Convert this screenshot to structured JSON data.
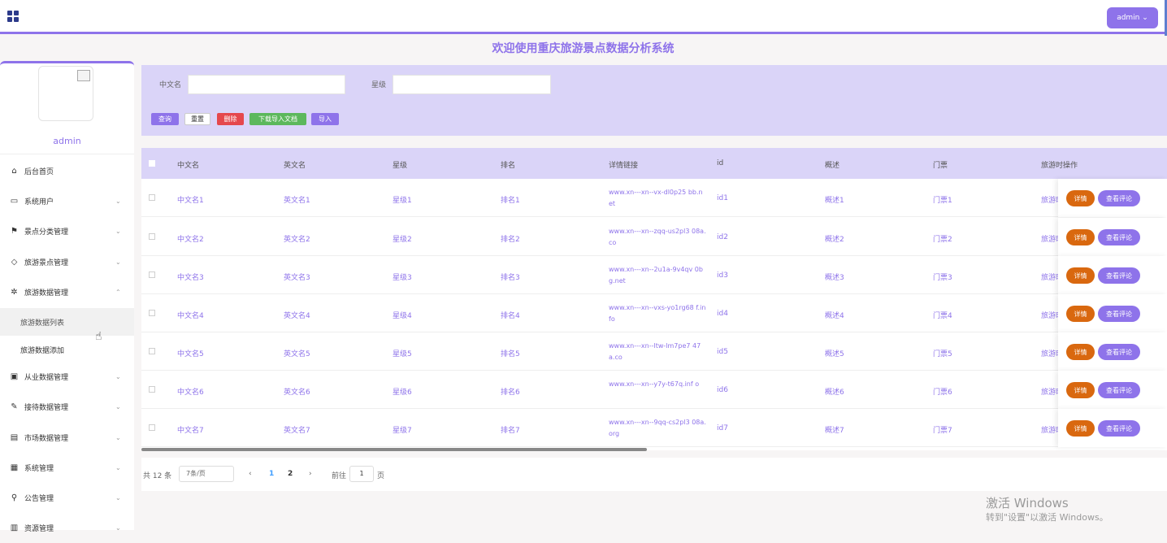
{
  "topbar": {
    "admin_label": "admin ⌄"
  },
  "header": {
    "title": "欢迎使用重庆旅游景点数据分析系统"
  },
  "sidebar": {
    "username": "admin",
    "items": [
      {
        "label": "后台首页",
        "icon": "⌂"
      },
      {
        "label": "系统用户",
        "icon": "▭"
      },
      {
        "label": "景点分类管理",
        "icon": "⚑"
      },
      {
        "label": "旅游景点管理",
        "icon": "◇"
      },
      {
        "label": "旅游数据管理",
        "icon": "✲"
      },
      {
        "label": "从业数据管理",
        "icon": "▣"
      },
      {
        "label": "接待数据管理",
        "icon": "✎"
      },
      {
        "label": "市场数据管理",
        "icon": "▤"
      },
      {
        "label": "系统管理",
        "icon": "▦"
      },
      {
        "label": "公告管理",
        "icon": "⚲"
      },
      {
        "label": "资源管理",
        "icon": "▥"
      }
    ],
    "subitems": [
      "旅游数据列表",
      "旅游数据添加"
    ]
  },
  "search": {
    "cn_label": "中文名",
    "level_label": "星级",
    "query_btn": "查询",
    "reset_btn": "重置",
    "delete_btn": "删除",
    "download_btn": "下载导入文档",
    "import_btn": "导入"
  },
  "table": {
    "headers": [
      "中文名",
      "英文名",
      "星级",
      "排名",
      "详情链接",
      "id",
      "概述",
      "门票",
      "旅游时",
      "操作"
    ],
    "rows": [
      {
        "cn": "中文名1",
        "en": "英文名1",
        "star": "星级1",
        "rank": "排名1",
        "link": "www.xn---xn--vx-dl0p25 bb.net",
        "id": "id1",
        "desc": "概述1",
        "ticket": "门票1",
        "time": "旅游时"
      },
      {
        "cn": "中文名2",
        "en": "英文名2",
        "star": "星级2",
        "rank": "排名2",
        "link": "www.xn---xn--zqq-us2pl3 08a.co",
        "id": "id2",
        "desc": "概述2",
        "ticket": "门票2",
        "time": "旅游时"
      },
      {
        "cn": "中文名3",
        "en": "英文名3",
        "star": "星级3",
        "rank": "排名3",
        "link": "www.xn---xn--2u1a-9v4qv 0bg.net",
        "id": "id3",
        "desc": "概述3",
        "ticket": "门票3",
        "time": "旅游时"
      },
      {
        "cn": "中文名4",
        "en": "英文名4",
        "star": "星级4",
        "rank": "排名4",
        "link": "www.xn---xn--vxs-yo1rg68 f.info",
        "id": "id4",
        "desc": "概述4",
        "ticket": "门票4",
        "time": "旅游时"
      },
      {
        "cn": "中文名5",
        "en": "英文名5",
        "star": "星级5",
        "rank": "排名5",
        "link": "www.xn---xn--ltw-lm7pe7 47a.co",
        "id": "id5",
        "desc": "概述5",
        "ticket": "门票5",
        "time": "旅游时"
      },
      {
        "cn": "中文名6",
        "en": "英文名6",
        "star": "星级6",
        "rank": "排名6",
        "link": "www.xn---xn--y7y-t67q.inf o",
        "id": "id6",
        "desc": "概述6",
        "ticket": "门票6",
        "time": "旅游时"
      },
      {
        "cn": "中文名7",
        "en": "英文名7",
        "star": "星级7",
        "rank": "排名7",
        "link": "www.xn---xn--9qq-cs2pl3 08a.org",
        "id": "id7",
        "desc": "概述7",
        "ticket": "门票7",
        "time": "旅游时"
      }
    ],
    "detail_btn": "详情",
    "comment_btn": "查看评论"
  },
  "pager": {
    "total": "共 12 条",
    "page_size": "7条/页",
    "prev": "‹",
    "next": "›",
    "page1": "1",
    "page2": "2",
    "goto": "前往",
    "goto_value": "1",
    "page_unit": "页"
  },
  "watermark": {
    "line1": "激活 Windows",
    "line2": "转到\"设置\"以激活 Windows。"
  },
  "colors": {
    "accent": "#8e73ea",
    "orange": "#d9680f",
    "red": "#e5484d",
    "green": "#5cb85c"
  }
}
